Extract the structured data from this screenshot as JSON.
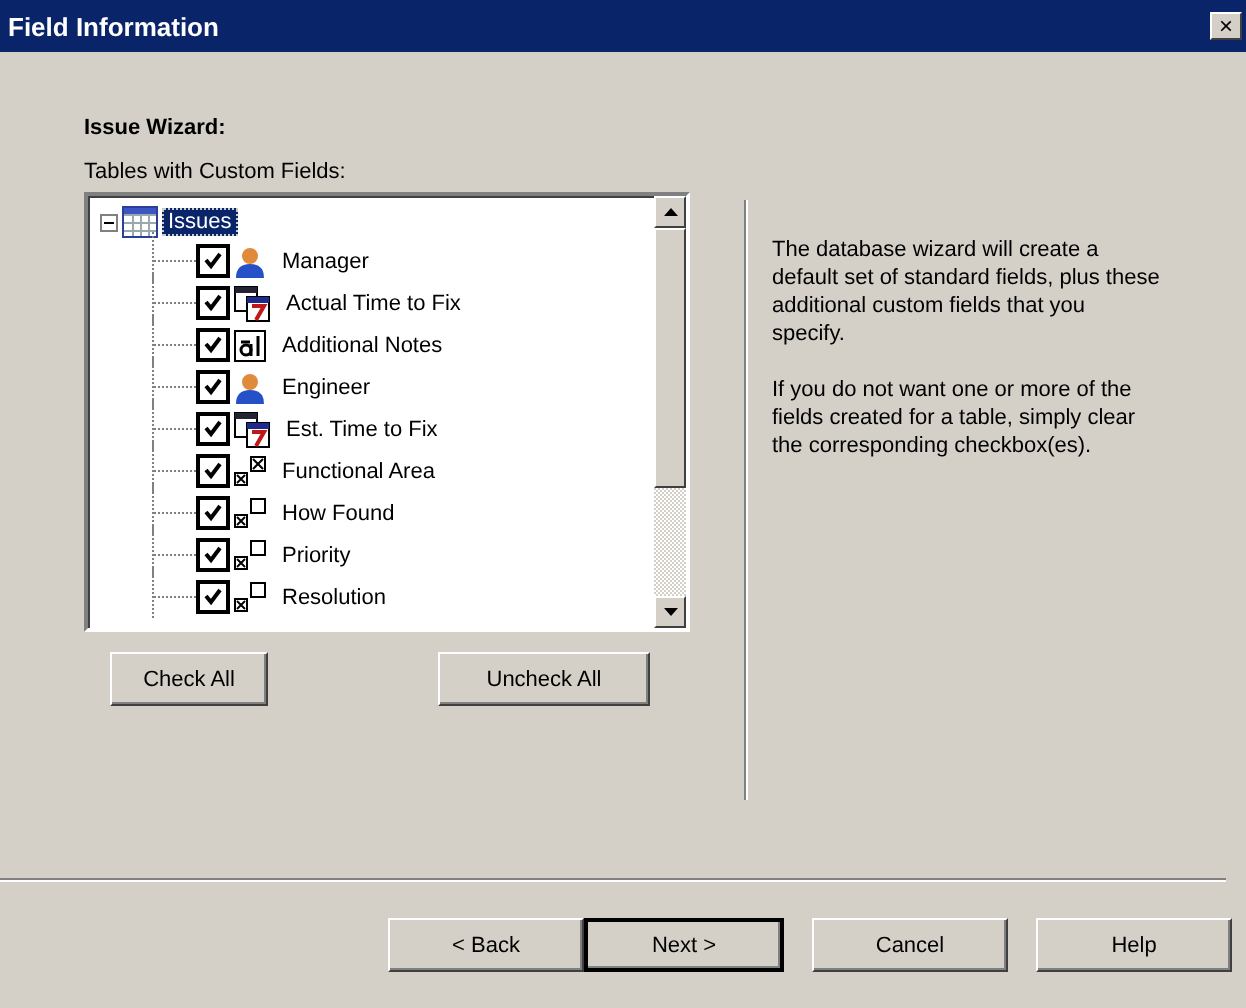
{
  "window": {
    "title": "Field Information",
    "close": "×"
  },
  "heading": "Issue Wizard:",
  "tree_label": "Tables with Custom Fields:",
  "tree": {
    "label": "Issues",
    "expanded": true,
    "selected": true,
    "children": [
      {
        "label": "Manager",
        "kind": "person",
        "checked": true
      },
      {
        "label": "Actual Time to Fix",
        "kind": "date",
        "checked": true
      },
      {
        "label": "Additional Notes",
        "kind": "text",
        "checked": true
      },
      {
        "label": "Engineer",
        "kind": "person",
        "checked": true
      },
      {
        "label": "Est. Time to Fix",
        "kind": "date",
        "checked": true
      },
      {
        "label": "Functional Area",
        "kind": "choice",
        "checked": true
      },
      {
        "label": "How Found",
        "kind": "list",
        "checked": true
      },
      {
        "label": "Priority",
        "kind": "list",
        "checked": true
      },
      {
        "label": "Resolution",
        "kind": "list",
        "checked": true
      }
    ]
  },
  "tree_buttons": [
    "Check All",
    "Uncheck All"
  ],
  "description": [
    "The database wizard will create a default set of standard fields, plus these additional custom fields that you specify.",
    "If you do not want one or more of the fields created for a table, simply clear the corresponding checkbox(es)."
  ],
  "buttons": [
    {
      "label": "< Back",
      "default": false
    },
    {
      "label": "Next >",
      "default": true
    },
    {
      "label": "Cancel",
      "default": false
    },
    {
      "label": "Help",
      "default": false
    }
  ]
}
